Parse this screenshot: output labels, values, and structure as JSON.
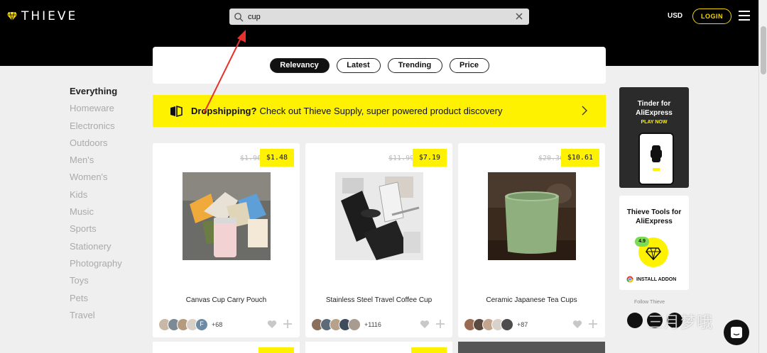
{
  "header": {
    "logo_text": "THIEVE",
    "search": {
      "value": "cup",
      "placeholder": ""
    },
    "currency": "USD",
    "login_label": "LOGIN"
  },
  "sort": {
    "options": [
      "Relevancy",
      "Latest",
      "Trending",
      "Price"
    ],
    "active": "Relevancy"
  },
  "categories": {
    "items": [
      "Everything",
      "Homeware",
      "Electronics",
      "Outdoors",
      "Men's",
      "Women's",
      "Kids",
      "Music",
      "Sports",
      "Stationery",
      "Photography",
      "Toys",
      "Pets",
      "Travel"
    ],
    "active": "Everything"
  },
  "banner": {
    "bold": "Dropshipping?",
    "text": "Check out Thieve Supply, super powered product discovery"
  },
  "products": [
    {
      "title": "Canvas Cup Carry Pouch",
      "old_price": "$1.96",
      "price": "$1.48",
      "extra_count": "+68",
      "last_avatar_letter": "F"
    },
    {
      "title": "Stainless Steel Travel Coffee Cup",
      "old_price": "$11.99",
      "price": "$7.19",
      "extra_count": "+1116"
    },
    {
      "title": "Ceramic Japanese Tea Cups",
      "old_price": "$20.36",
      "price": "$10.61",
      "extra_count": "+87"
    }
  ],
  "ads": {
    "tinder_title": "Tinder for AliExpress",
    "tinder_cta": "PLAY NOW",
    "tools_title": "Thieve Tools for AliExpress",
    "tools_rating": "4.9",
    "install_label": "INSTALL ADDON",
    "follow_label": "Follow Thieve"
  },
  "watermark": "三月梦哦",
  "colors": {
    "accent": "#fff200",
    "dark": "#000000",
    "background": "#efefef"
  }
}
